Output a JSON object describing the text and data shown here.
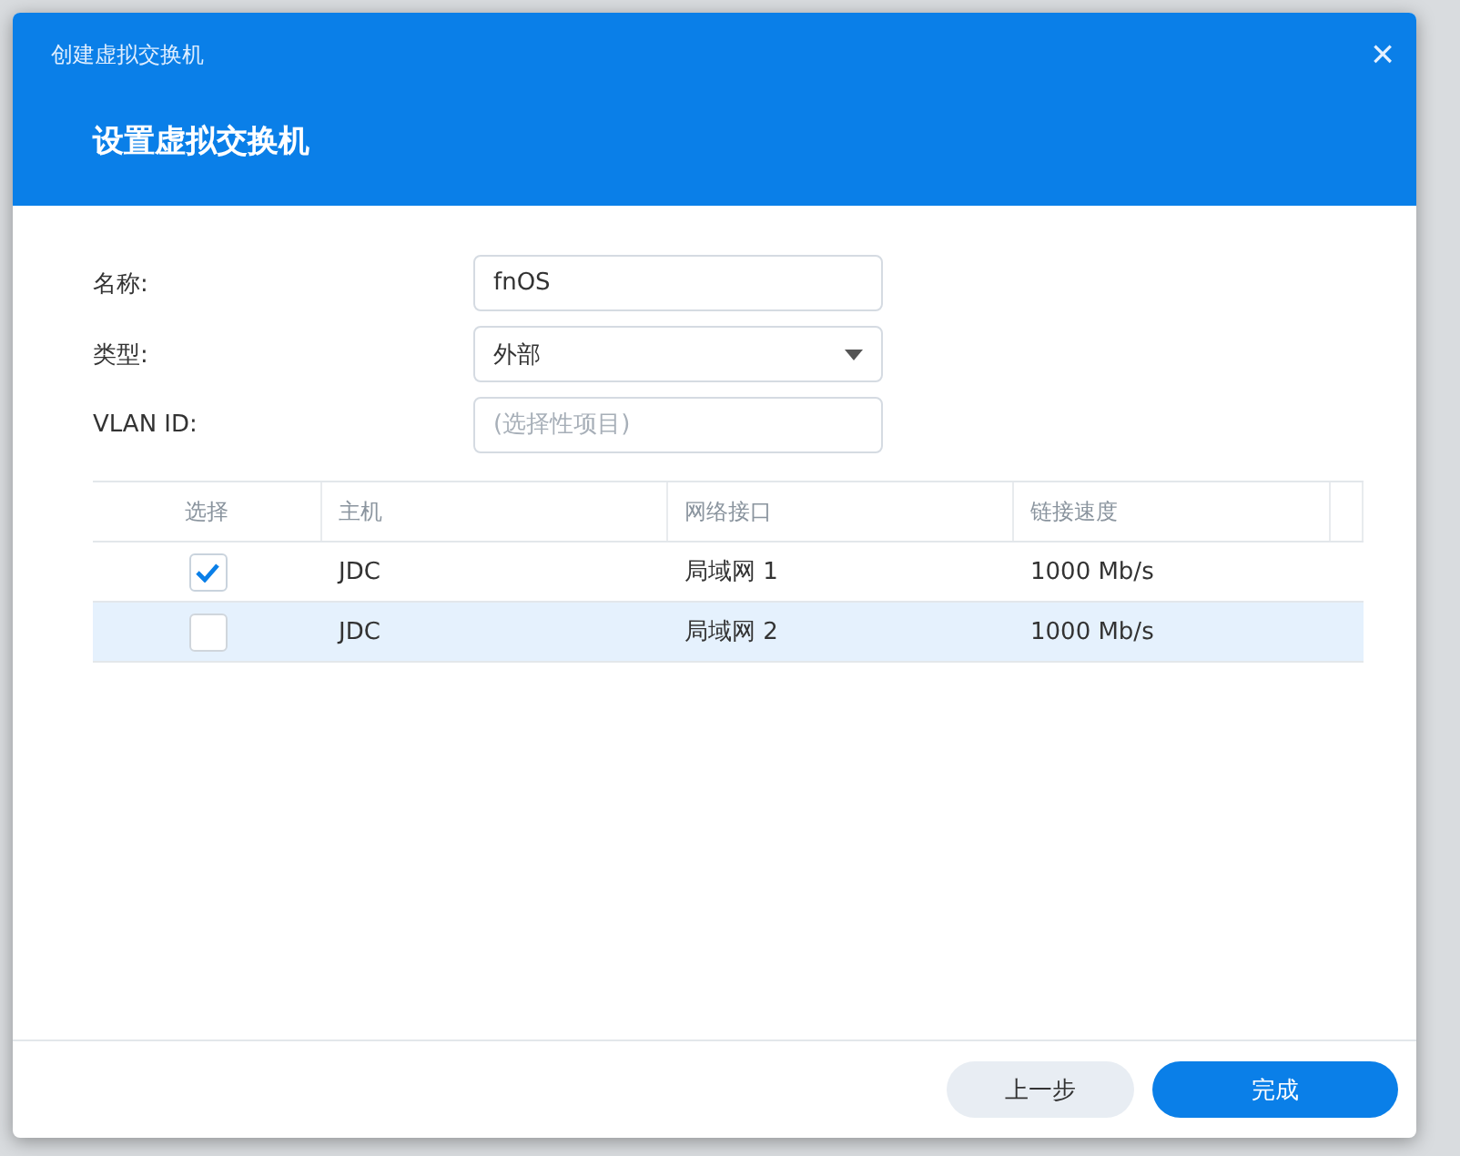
{
  "dialog": {
    "title": "创建虚拟交换机",
    "step_title": "设置虚拟交换机",
    "close": "×"
  },
  "form": [
    {
      "kind": "text",
      "label": "名称:",
      "value": "fnOS"
    },
    {
      "kind": "select",
      "label": "类型:",
      "value": "外部"
    },
    {
      "kind": "text",
      "label": "VLAN ID:",
      "placeholder": "(选择性项目)"
    }
  ],
  "table": {
    "columns": [
      "选择",
      "主机",
      "网络接口",
      "链接速度"
    ],
    "rows": [
      {
        "checked": true,
        "selected": false,
        "cells": [
          "",
          "JDC",
          "局域网 1",
          "1000 Mb/s"
        ]
      },
      {
        "checked": false,
        "selected": true,
        "cells": [
          "",
          "JDC",
          "局域网 2",
          "1000 Mb/s"
        ]
      }
    ]
  },
  "buttons": [
    {
      "kind": "secondary",
      "label": "上一步"
    },
    {
      "kind": "primary",
      "label": "完成"
    }
  ]
}
